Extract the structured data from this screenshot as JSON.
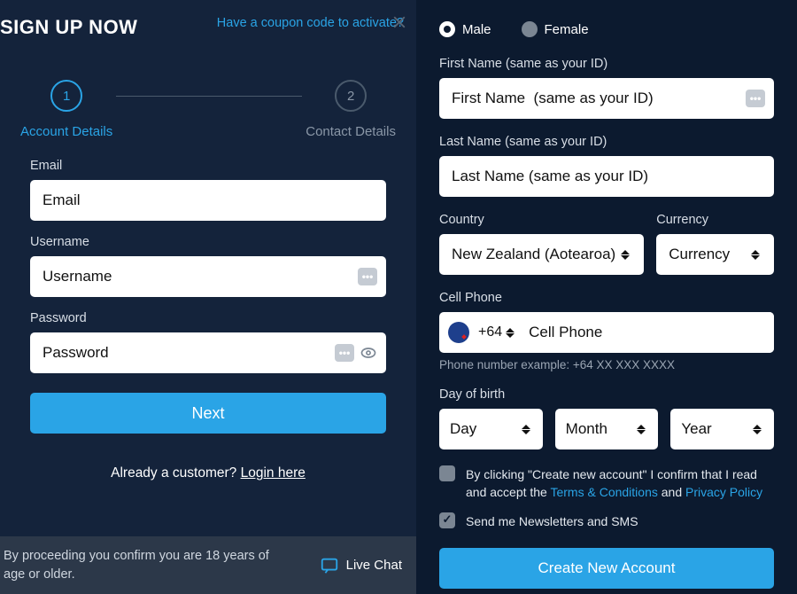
{
  "left": {
    "title": "SIGN UP NOW",
    "coupon": "Have a coupon code to activate?",
    "steps": {
      "s1": {
        "num": "1",
        "label": "Account Details"
      },
      "s2": {
        "num": "2",
        "label": "Contact Details"
      }
    },
    "email": {
      "label": "Email",
      "placeholder": "Email"
    },
    "username": {
      "label": "Username",
      "placeholder": "Username"
    },
    "password": {
      "label": "Password",
      "placeholder": "Password"
    },
    "next_btn": "Next",
    "already": "Already a customer? ",
    "login_here": "Login here",
    "legal": "By proceeding you confirm you are 18 years of age or older.",
    "live_chat": "Live Chat",
    "dots": "•••"
  },
  "right": {
    "gender": {
      "male": "Male",
      "female": "Female"
    },
    "first_name": {
      "label": "First Name (same as your ID)",
      "placeholder": "First Name  (same as your ID)"
    },
    "last_name": {
      "label": "Last Name (same as your ID)",
      "placeholder": "Last Name (same as your ID)"
    },
    "country": {
      "label": "Country",
      "value": "New Zealand (Aotearoa)"
    },
    "currency": {
      "label": "Currency",
      "value": "Currency"
    },
    "phone": {
      "label": "Cell Phone",
      "dial": "+64",
      "placeholder": "Cell Phone",
      "note": "Phone number example: +64 XX XXX XXXX"
    },
    "dob": {
      "label": "Day of birth",
      "day": "Day",
      "month": "Month",
      "year": "Year"
    },
    "terms": {
      "pre": "By clicking \"Create new account\" I confirm that I read and accept the ",
      "tc": "Terms & Conditions",
      "mid": " and ",
      "pp": "Privacy Policy"
    },
    "newsletter": "Send me Newsletters and SMS",
    "create_btn": "Create New Account"
  }
}
